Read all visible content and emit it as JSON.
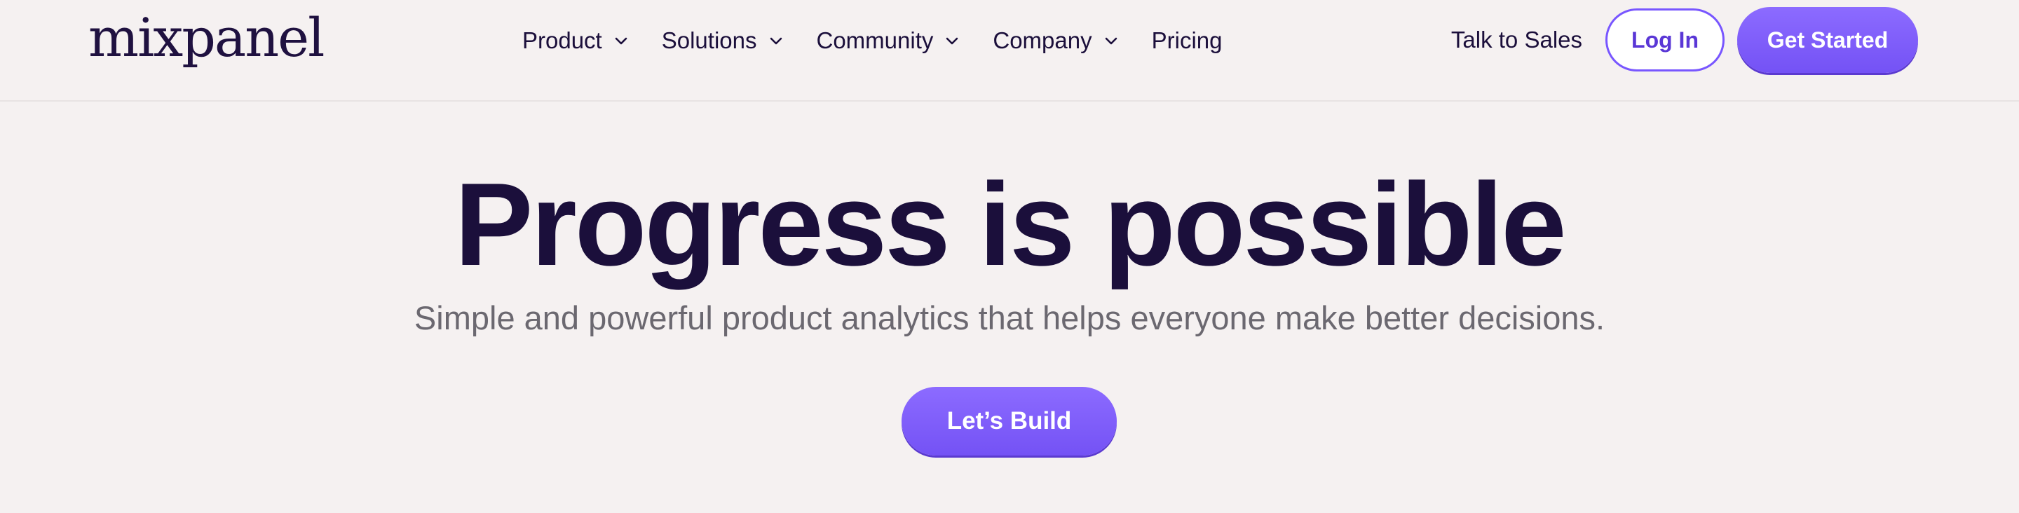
{
  "brand": {
    "logo_text": "mixpanel",
    "accent_color": "#7856ff",
    "text_color": "#1b0f3b",
    "background": "#f5f1f1"
  },
  "nav": {
    "items": [
      {
        "label": "Product",
        "has_dropdown": true,
        "icon": "chevron-down-icon"
      },
      {
        "label": "Solutions",
        "has_dropdown": true,
        "icon": "chevron-down-icon"
      },
      {
        "label": "Community",
        "has_dropdown": true,
        "icon": "chevron-down-icon"
      },
      {
        "label": "Company",
        "has_dropdown": true,
        "icon": "chevron-down-icon"
      },
      {
        "label": "Pricing",
        "has_dropdown": false
      }
    ],
    "talk_to_sales": "Talk to Sales",
    "login_label": "Log In",
    "get_started_label": "Get Started"
  },
  "hero": {
    "title": "Progress is possible",
    "subtitle": "Simple and powerful product analytics that helps everyone make better decisions.",
    "cta_label": "Let’s Build"
  }
}
